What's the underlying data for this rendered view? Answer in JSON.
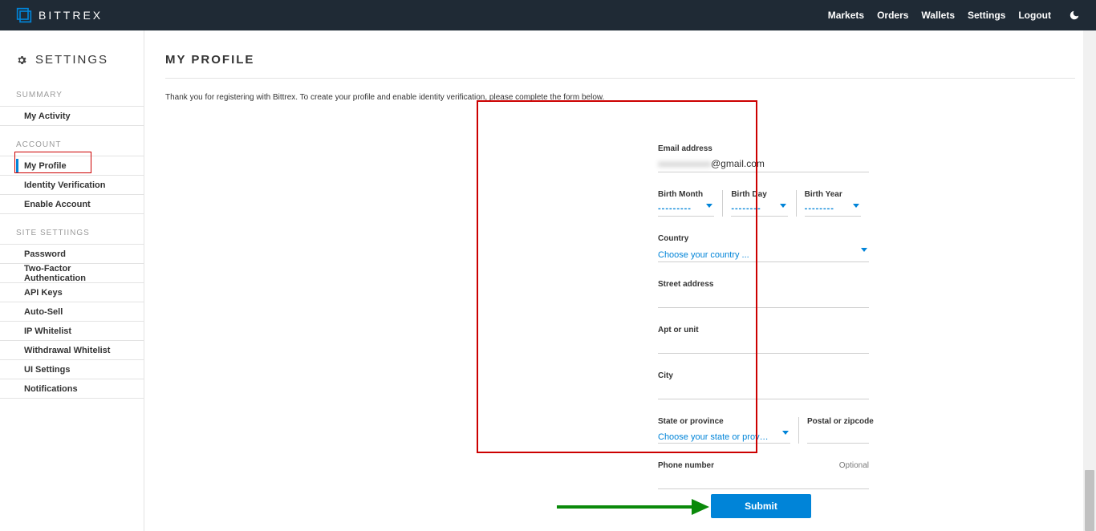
{
  "brand": "BITTREX",
  "header_nav": {
    "markets": "Markets",
    "orders": "Orders",
    "wallets": "Wallets",
    "settings": "Settings",
    "logout": "Logout"
  },
  "sidebar": {
    "title": "SETTINGS",
    "groups": {
      "summary": {
        "label": "SUMMARY",
        "items": [
          "My Activity"
        ]
      },
      "account": {
        "label": "ACCOUNT",
        "items": [
          "My Profile",
          "Identity Verification",
          "Enable Account"
        ]
      },
      "site": {
        "label": "SITE SETTIINGS",
        "items": [
          "Password",
          "Two-Factor Authentication",
          "API Keys",
          "Auto-Sell",
          "IP Whitelist",
          "Withdrawal Whitelist",
          "UI Settings",
          "Notifications"
        ]
      }
    }
  },
  "page": {
    "title": "MY PROFILE",
    "intro": "Thank you for registering with Bittrex. To create your profile and enable identity verification, please complete the form below."
  },
  "form": {
    "email_label": "Email address",
    "email_blur": "xxxxxxxxxxxx",
    "email_domain": "@gmail.com",
    "birth_month_label": "Birth Month",
    "birth_day_label": "Birth Day",
    "birth_year_label": "Birth Year",
    "birth_placeholder": "---------",
    "birth_placeholder_short": "--------",
    "country_label": "Country",
    "country_placeholder": "Choose your country ...",
    "street_label": "Street address",
    "apt_label": "Apt or unit",
    "city_label": "City",
    "state_label": "State or province",
    "state_placeholder": "Choose your state or province ...",
    "postal_label": "Postal or zipcode",
    "phone_label": "Phone number",
    "optional": "Optional",
    "submit": "Submit"
  }
}
